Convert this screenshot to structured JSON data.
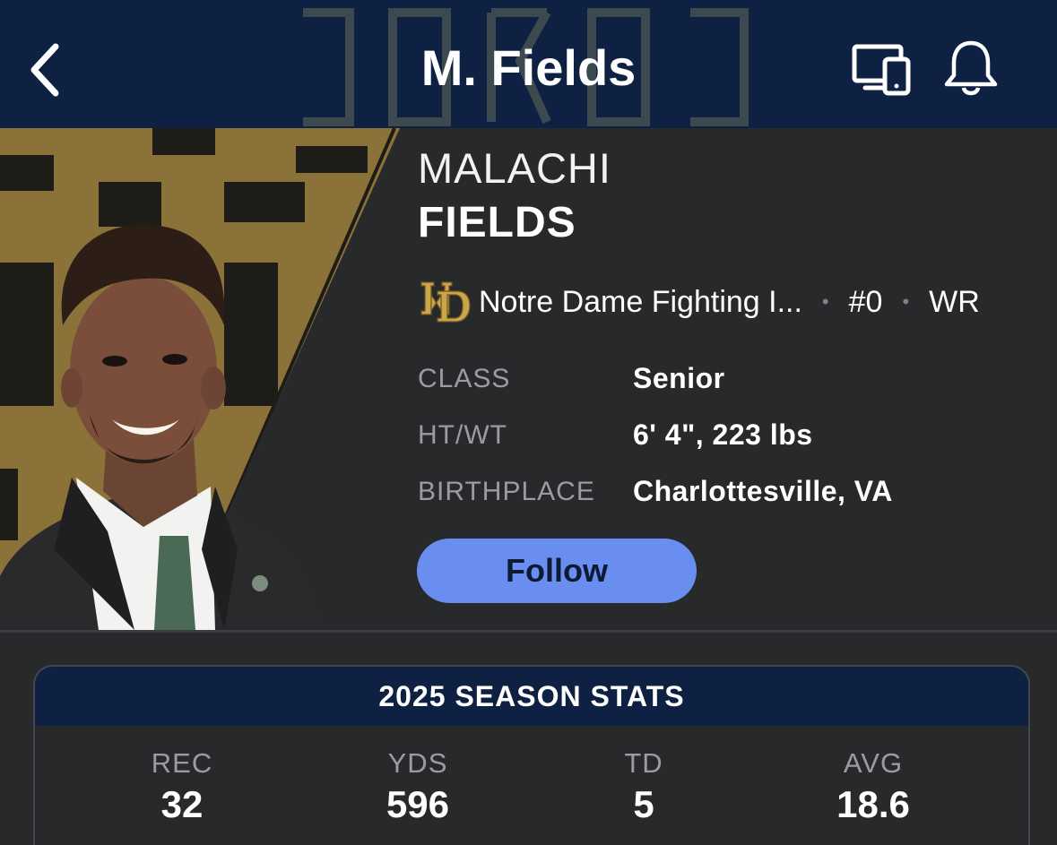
{
  "header": {
    "title": "M. Fields",
    "back_icon": "chevron-left-icon",
    "cast_icon": "devices-icon",
    "notify_icon": "bell-icon"
  },
  "player": {
    "first_name": "MALACHI",
    "last_name": "FIELDS",
    "team": "Notre Dame Fighting I...",
    "number": "#0",
    "position": "WR",
    "separator": "•",
    "info": [
      {
        "label": "CLASS",
        "value": "Senior"
      },
      {
        "label": "HT/WT",
        "value": "6' 4\", 223 lbs"
      },
      {
        "label": "BIRTHPLACE",
        "value": "Charlottesville, VA"
      }
    ],
    "follow_label": "Follow"
  },
  "stats": {
    "title": "2025 SEASON STATS",
    "items": [
      {
        "label": "REC",
        "value": "32"
      },
      {
        "label": "YDS",
        "value": "596"
      },
      {
        "label": "TD",
        "value": "5"
      },
      {
        "label": "AVG",
        "value": "18.6"
      }
    ]
  },
  "colors": {
    "header_bg": "#0f2142",
    "page_bg": "#28292b",
    "accent_gold": "#c9a64a",
    "follow_button": "#6a8ef0"
  }
}
